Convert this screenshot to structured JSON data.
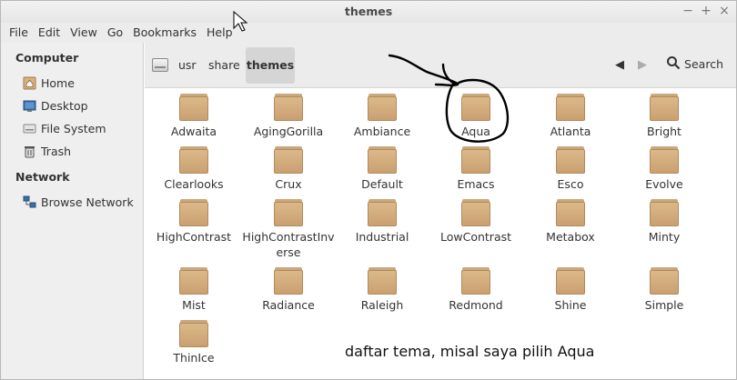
{
  "window": {
    "title": "themes",
    "controls": [
      "−",
      "+",
      "×"
    ]
  },
  "menu": [
    "File",
    "Edit",
    "View",
    "Go",
    "Bookmarks",
    "Help"
  ],
  "sidebar": {
    "computer_heading": "Computer",
    "computer_items": [
      {
        "label": "Home",
        "icon": "home-icon"
      },
      {
        "label": "Desktop",
        "icon": "desktop-icon"
      },
      {
        "label": "File System",
        "icon": "drive-icon"
      },
      {
        "label": "Trash",
        "icon": "trash-icon"
      }
    ],
    "network_heading": "Network",
    "network_items": [
      {
        "label": "Browse Network",
        "icon": "network-icon"
      }
    ]
  },
  "toolbar": {
    "path": [
      "usr",
      "share",
      "themes"
    ],
    "back": "◀",
    "forward": "▶",
    "search_label": "Search"
  },
  "folders": [
    "Adwaita",
    "AgingGorilla",
    "Ambiance",
    "Aqua",
    "Atlanta",
    "Bright",
    "Clearlooks",
    "Crux",
    "Default",
    "Emacs",
    "Esco",
    "Evolve",
    "HighContrast",
    "HighContrastInverse",
    "Industrial",
    "LowContrast",
    "Metabox",
    "Minty",
    "Mist",
    "Radiance",
    "Raleigh",
    "Redmond",
    "Shine",
    "Simple",
    "ThinIce"
  ],
  "annotation": "daftar tema, misal saya pilih Aqua",
  "colors": {
    "folder": "#caa071",
    "sidebar_bg": "#efefef",
    "toolbar_bg": "#ececec",
    "active_crumb": "#d5d5d5"
  }
}
